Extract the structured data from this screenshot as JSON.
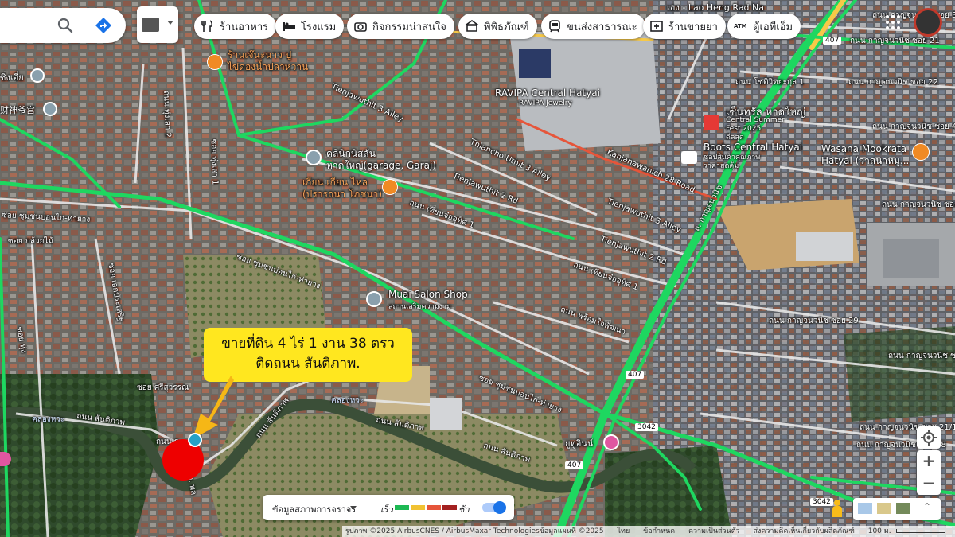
{
  "search": {
    "search_icon": "search-icon",
    "directions_icon": "directions-icon"
  },
  "layers_icon": "layers-icon",
  "chips": [
    {
      "label": "ร้านอาหาร",
      "icon": "restaurant-icon"
    },
    {
      "label": "โรงแรม",
      "icon": "hotel-icon"
    },
    {
      "label": "กิจกรรมน่าสนใจ",
      "icon": "camera-icon"
    },
    {
      "label": "พิพิธภัณฑ์",
      "icon": "museum-icon"
    },
    {
      "label": "ขนส่งสาธารณะ",
      "icon": "transit-icon"
    },
    {
      "label": "ร้านขายยา",
      "icon": "pharmacy-icon"
    },
    {
      "label": "ตู้เอทีเอ็ม",
      "icon": "atm-icon",
      "badge": "ATM"
    }
  ],
  "places": [
    {
      "name": "ร้านเจ๊นะนาว ปู\nไข่ดองน้ำปลาหวาน",
      "icon": "restaurant-pin-icon"
    },
    {
      "name": "RAVIPA Central Hatyai",
      "sub": "RAVIPA Jewelry"
    },
    {
      "name": "เซ็นทรัล หาดใหญ่",
      "sub": "Central Summer\nFest 2025\nดีลสุด",
      "icon": "shopping-pin-icon"
    },
    {
      "name": "Boots Central Hatyai",
      "sub": "ซอปสินค้าคุณภาพ\nราคาสุดคุ้ม",
      "icon": "store-icon"
    },
    {
      "name": "Wasana Mookrata\nHatyai (วาสนาหมู...",
      "icon": "restaurant-pin-icon"
    },
    {
      "name": "คลินิกนิสสัน\nหาดใหญ่(garage, Garaj)",
      "icon": "place-pin-icon"
    },
    {
      "name": "เกียน เกียน ไหล\n(ปรารถนา โภชนา)",
      "icon": "restaurant-pin-icon"
    },
    {
      "name": "Muai Salon Shop",
      "sub": "สถานเสริมความงาม",
      "icon": "place-pin-icon"
    },
    {
      "name": "ยูทูอินน์",
      "icon": "hotel-pin-icon"
    },
    {
      "name": "Lao Heng Rad Na",
      "prefix": "เฮง -"
    }
  ],
  "streets": [
    "Tienjawuthit 3 Alley",
    "Thiancho Uthit 3 Alley",
    "Tienjawuthit 2 Rd",
    "Kanjanawanich 28 Road",
    "Tienjawuthit 3 Alley",
    "Tienjawuthit 2 Rd",
    "ถนน เทียนจ๋ออุทิศ 1",
    "ถนน เทียนจ๋ออุทิศ 1",
    "ซอย ชุมชนบ่อนไก่-ท่ายาง",
    "ซอย ชุมชนบ่อนไก่-ท่ายาง",
    "ซอย ชุมชนบ่อนไก่-ท่ายาง",
    "ซอย กล้วยไม้",
    "ซอย เอกประเสริฐ",
    "ถนน พร้อมใจพัฒนา",
    "ซอย ศรีสุวรรณ",
    "ถนน สันติภาพ",
    "ถนน สันติภาพ",
    "ถนน สันติภาพ",
    "ถนน สันติภาพ",
    "ถ. กาญจนวนิช",
    "ถนน กาญจนวนิช ซอย 21",
    "ถนน กาญจนวนิช ซอย 22",
    "ถนน กาญจนวนิช ซอย 29",
    "ถนน กาญจนวนิช ซอย 28",
    "ถนน โชติวิทยะกุล 1",
    "ถนน ทุ่งเสา 2",
    "ซอย ทุ่งเสา 1",
    "คลองหวะ",
    "คลองหวะ",
    "ถนน กาญจนวนิช ซอย 3",
    "ถนน กาญจนวนิช ซอย 4",
    "ถนน ทุ่งสรรพ",
    "ถนน กาญจนวนิช ซอย",
    "ถนน สันติภาพ",
    "ซอย ชุมชนบ่อนไก่-ท่ายาง",
    "ถนน กาญจนวนิช ซอย",
    "ถนน กาญจนวนิช ซอย 21/1",
    "ถนน กาญจนวนิช ซอย 30",
    "ถนน กาญจนวนิช ซอย 33",
    "ถนน กาญจนวนิช ซอย 32",
    "คลองหวะ",
    "ถนน โชติ",
    "ถนน ทุ่งเสา",
    "ซอย ทุ่ง",
    "ต. เทศ",
    "ซอย 3",
    "ต. พล",
    "ถนน สันติภาพ",
    "ซอยงาม",
    "ซอย ชุมชน",
    "ถนน ร",
    "ถ.",
    "ต."
  ],
  "left_edge": [
    "ซิ่งเอี๋ย",
    "财神爷宫"
  ],
  "highway_shields": [
    "407",
    "407",
    "407",
    "3042",
    "3042",
    "3042"
  ],
  "callout": {
    "line1": "ขายที่ดิน 4 ไร่ 1 งาน 38 ตรว",
    "line2": "ติดถนน สันติภาพ."
  },
  "traffic": {
    "label": "ข้อมูลสภาพการจราจร",
    "fast": "เร็ว",
    "slow": "ช้า",
    "colors": [
      "#1db954",
      "#f1c232",
      "#e6553a",
      "#a32020"
    ]
  },
  "attribution": {
    "imagery": "รูปภาพ ©2025 AirbusCNES / AirbusMaxar Technologiesข้อมูลแผนที่ ©2025",
    "thai": "ไทย",
    "terms": "ข้อกำหนด",
    "privacy": "ความเป็นส่วนตัว",
    "feedback": "ส่งความคิดเห็นเกี่ยวกับผลิตภัณฑ์",
    "scale": "100 ม."
  },
  "colors": {
    "traffic_green": "#1ed760",
    "traffic_yellow": "#f7c948",
    "marker_red": "#ee0000",
    "callout_yellow": "#ffe71f",
    "arrow_orange": "#f6b716",
    "poi_orange": "#f08a24"
  }
}
